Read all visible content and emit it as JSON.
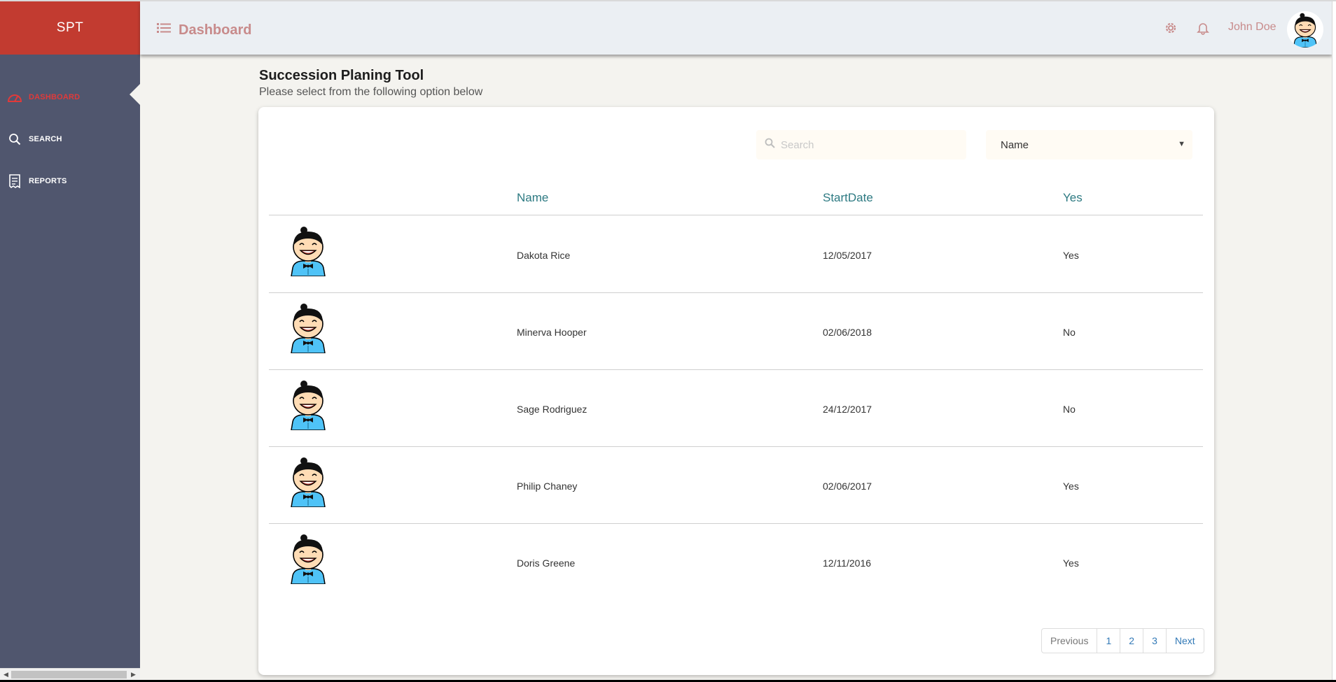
{
  "sidebar": {
    "brand": "SPT",
    "items": [
      {
        "label": "DASHBOARD",
        "icon": "gauge-icon",
        "active": true
      },
      {
        "label": "SEARCH",
        "icon": "search-icon"
      },
      {
        "label": "REPORTS",
        "icon": "receipt-icon"
      }
    ]
  },
  "header": {
    "title": "Dashboard",
    "user_name": "John Doe"
  },
  "main": {
    "title": "Succession Planing Tool",
    "subtitle": "Please select from the following option below",
    "search": {
      "placeholder": "Search",
      "value": ""
    },
    "sort": {
      "selected": "Name"
    },
    "table": {
      "columns": [
        "Name",
        "StartDate",
        "Yes"
      ],
      "rows": [
        {
          "name": "Dakota Rice",
          "start_date": "12/05/2017",
          "status": "Yes"
        },
        {
          "name": "Minerva Hooper",
          "start_date": "02/06/2018",
          "status": "No"
        },
        {
          "name": "Sage Rodriguez",
          "start_date": "24/12/2017",
          "status": "No"
        },
        {
          "name": "Philip Chaney",
          "start_date": "02/06/2017",
          "status": "Yes"
        },
        {
          "name": "Doris Greene",
          "start_date": "12/11/2016",
          "status": "Yes"
        }
      ]
    },
    "pagination": {
      "previous": "Previous",
      "pages": [
        "1",
        "2",
        "3"
      ],
      "next": "Next"
    }
  },
  "colors": {
    "brand": "#c23b30",
    "sidebar": "#50566e",
    "active_nav": "#e03a3a",
    "header_text": "#c88b8b",
    "column_header": "#2d7a82",
    "link": "#337ab7"
  }
}
